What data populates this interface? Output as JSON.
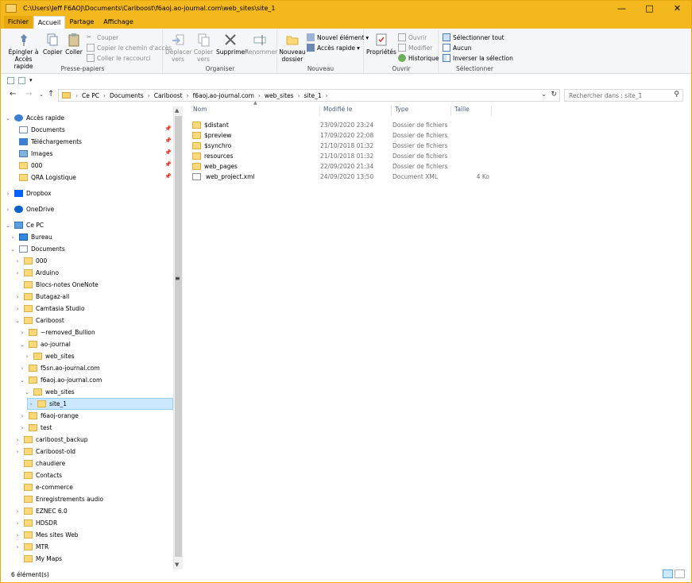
{
  "window": {
    "title": "C:\\Users\\Jeff F6AOJ\\Documents\\Cariboost\\f6aoj.ao-journal.com\\web_sites\\site_1",
    "minimize": "—",
    "maximize": "□",
    "close": "✕"
  },
  "tabs": {
    "file": "Fichier",
    "home": "Accueil",
    "share": "Partage",
    "view": "Affichage"
  },
  "ribbon": {
    "clipboard": {
      "pin": "Épingler à Accès rapide",
      "copy": "Copier",
      "paste": "Coller",
      "cut": "Couper",
      "copy_path": "Copier le chemin d'accès",
      "paste_shortcut": "Coller le raccourci",
      "label": "Presse-papiers"
    },
    "organize": {
      "move_to": "Déplacer vers",
      "copy_to": "Copier vers",
      "delete": "Supprimer",
      "rename": "Renommer",
      "label": "Organiser"
    },
    "new": {
      "new_folder": "Nouveau dossier",
      "new_item": "Nouvel élément",
      "easy_access": "Accès rapide",
      "label": "Nouveau"
    },
    "open": {
      "properties": "Propriétés",
      "open": "Ouvrir",
      "edit": "Modifier",
      "history": "Historique",
      "label": "Ouvrir"
    },
    "select": {
      "select_all": "Sélectionner tout",
      "select_none": "Aucun",
      "invert": "Inverser la sélection",
      "label": "Sélectionner"
    }
  },
  "address": {
    "crumbs": [
      "Ce PC",
      "Documents",
      "Cariboost",
      "f6aoj.ao-journal.com",
      "web_sites",
      "site_1"
    ],
    "search_placeholder": "Rechercher dans : site_1"
  },
  "nav": {
    "items": [
      {
        "label": "Accès rapide",
        "icon": "star-icon",
        "pinned": false
      },
      {
        "label": "Documents",
        "icon": "documents-icon",
        "pinned": true
      },
      {
        "label": "Téléchargements",
        "icon": "download-icon",
        "pinned": true
      },
      {
        "label": "Images",
        "icon": "images-icon",
        "pinned": true
      },
      {
        "label": "000",
        "icon": "folder-icon",
        "pinned": true
      },
      {
        "label": "QRA Logistique",
        "icon": "folder-icon",
        "pinned": true
      },
      {
        "label": "Dropbox",
        "icon": "dropbox-icon",
        "pinned": false
      },
      {
        "label": "OneDrive",
        "icon": "cloud-icon",
        "pinned": false
      },
      {
        "label": "Ce PC",
        "icon": "computer-icon",
        "pinned": false
      },
      {
        "label": "Bureau",
        "icon": "desktop-icon",
        "pinned": false
      },
      {
        "label": "Documents",
        "icon": "documents-icon",
        "pinned": false
      },
      {
        "label": "000",
        "icon": "folder-icon",
        "pinned": false
      },
      {
        "label": "Arduino",
        "icon": "folder-icon",
        "pinned": false
      },
      {
        "label": "Blocs-notes OneNote",
        "icon": "folder-icon",
        "pinned": false
      },
      {
        "label": "Butagaz-all",
        "icon": "folder-icon",
        "pinned": false
      },
      {
        "label": "Camtasia Studio",
        "icon": "folder-icon",
        "pinned": false
      },
      {
        "label": "Cariboost",
        "icon": "folder-icon",
        "pinned": false
      },
      {
        "label": "~removed_Bullion",
        "icon": "folder-icon",
        "pinned": false
      },
      {
        "label": "ao-journal",
        "icon": "folder-icon",
        "pinned": false
      },
      {
        "label": "web_sites",
        "icon": "folder-icon",
        "pinned": false
      },
      {
        "label": "f5sn.ao-journal.com",
        "icon": "folder-icon",
        "pinned": false
      },
      {
        "label": "f6aoj.ao-journal.com",
        "icon": "folder-icon",
        "pinned": false
      },
      {
        "label": "web_sites",
        "icon": "folder-icon",
        "pinned": false
      },
      {
        "label": "site_1",
        "icon": "folder-icon",
        "pinned": false
      },
      {
        "label": "f6aoj-orange",
        "icon": "folder-icon",
        "pinned": false
      },
      {
        "label": "test",
        "icon": "folder-icon",
        "pinned": false
      },
      {
        "label": "cariboost_backup",
        "icon": "folder-icon",
        "pinned": false
      },
      {
        "label": "Cariboost-old",
        "icon": "folder-icon",
        "pinned": false
      },
      {
        "label": "chaudiere",
        "icon": "folder-icon",
        "pinned": false
      },
      {
        "label": "Contacts",
        "icon": "folder-icon",
        "pinned": false
      },
      {
        "label": "e-commerce",
        "icon": "folder-icon",
        "pinned": false
      },
      {
        "label": "Enregistrements audio",
        "icon": "folder-icon",
        "pinned": false
      },
      {
        "label": "EZNEC 6.0",
        "icon": "folder-icon",
        "pinned": false
      },
      {
        "label": "HDSDR",
        "icon": "folder-icon",
        "pinned": false
      },
      {
        "label": "Mes sites Web",
        "icon": "folder-icon",
        "pinned": false
      },
      {
        "label": "MTR",
        "icon": "folder-icon",
        "pinned": false
      },
      {
        "label": "My Maps",
        "icon": "folder-icon",
        "pinned": false
      }
    ]
  },
  "columns": {
    "name": "Nom",
    "modified": "Modifié le",
    "type": "Type",
    "size": "Taille"
  },
  "files": [
    {
      "name": "$distant",
      "modified": "23/09/2020 23:24",
      "type": "Dossier de fichiers",
      "size": "",
      "icon": "folder-icon"
    },
    {
      "name": "$preview",
      "modified": "17/09/2020 22:08",
      "type": "Dossier de fichiers",
      "size": "",
      "icon": "folder-icon"
    },
    {
      "name": "$synchro",
      "modified": "21/10/2018 01:32",
      "type": "Dossier de fichiers",
      "size": "",
      "icon": "folder-icon"
    },
    {
      "name": "resources",
      "modified": "21/10/2018 01:32",
      "type": "Dossier de fichiers",
      "size": "",
      "icon": "folder-icon"
    },
    {
      "name": "web_pages",
      "modified": "22/09/2020 21:34",
      "type": "Dossier de fichiers",
      "size": "",
      "icon": "folder-icon"
    },
    {
      "name": "web_project.xml",
      "modified": "24/09/2020 13:50",
      "type": "Document XML",
      "size": "4 Ko",
      "icon": "xml-file-icon"
    }
  ],
  "status": {
    "count": "6 élément(s)"
  }
}
